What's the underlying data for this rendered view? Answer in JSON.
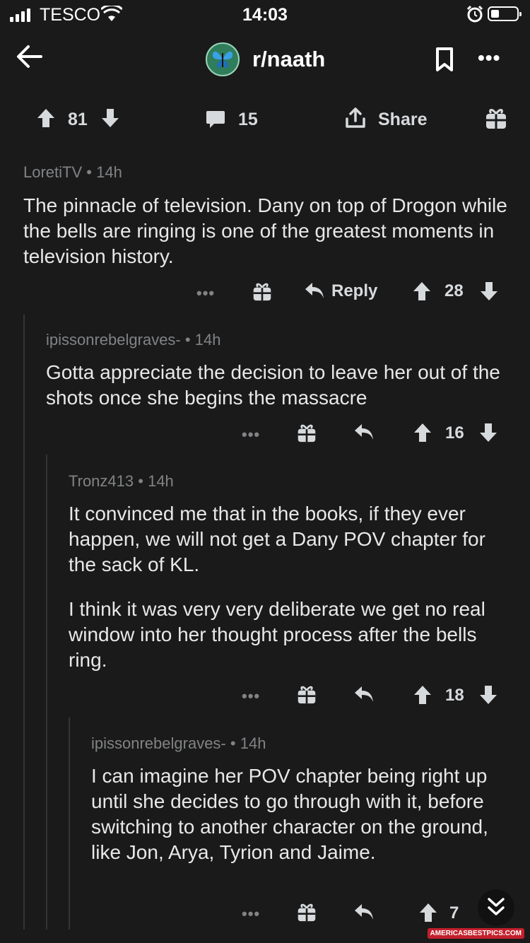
{
  "status_bar": {
    "carrier": "TESCO",
    "time": "14:03"
  },
  "header": {
    "subreddit": "r/naath",
    "more_label": "•••"
  },
  "post_actions": {
    "votes": "81",
    "comments": "15",
    "share_label": "Share"
  },
  "comments": [
    {
      "author": "LoretiTV",
      "age": "14h",
      "sep": "•",
      "body": [
        "The pinnacle of television. Dany on top of Drogon while the bells are ringing is one of the greatest moments in television history."
      ],
      "reply_label": "Reply",
      "score": "28",
      "more": "•••"
    },
    {
      "author": "ipissonrebelgraves-",
      "age": "14h",
      "sep": "•",
      "body": [
        "Gotta appreciate the decision to leave her out of the shots once she begins the massacre"
      ],
      "score": "16",
      "more": "•••"
    },
    {
      "author": "Tronz413",
      "age": "14h",
      "sep": "•",
      "body": [
        "It convinced me that in the books, if they ever happen, we will not get a Dany POV chapter for the sack of KL.",
        "I think it was very very deliberate we get no real window into her thought process after the bells ring."
      ],
      "score": "18",
      "more": "•••"
    },
    {
      "author": "ipissonrebelgraves-",
      "age": "14h",
      "sep": "•",
      "body": [
        "I can imagine her POV chapter being right up until she decides to go through with it, before switching to another character on the ground, like Jon, Arya, Tyrion and Jaime."
      ],
      "score": "7",
      "more": "•••"
    }
  ],
  "watermark": "AMERICASBESTPICS.COM",
  "colors": {
    "background": "#1a1a1b",
    "text": "#d7dadc",
    "meta": "#818384"
  }
}
